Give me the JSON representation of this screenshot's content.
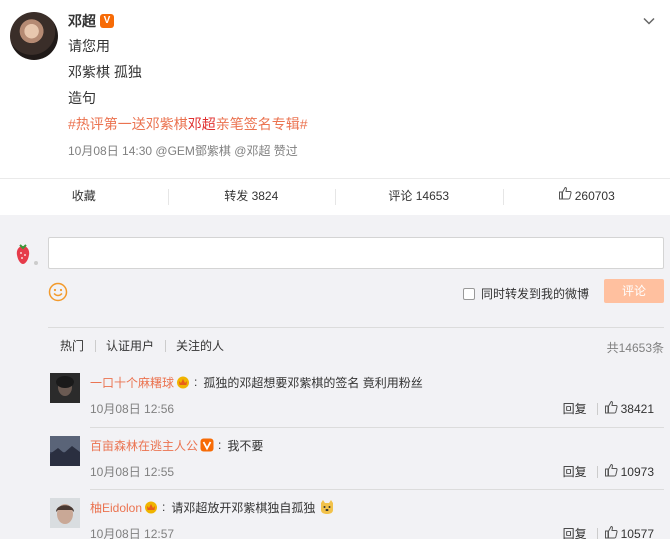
{
  "post": {
    "author": "邓超",
    "badge": "V",
    "lines": [
      "请您用",
      "邓紫棋 孤独",
      "造句"
    ],
    "hashtag_pre": "#热评第一送邓紫棋",
    "hashtag_hl": "邓超",
    "hashtag_post": "亲笔签名专辑#",
    "time": "10月08日 14:30",
    "meta_mentions": "@GEM鄧紫棋 @邓超",
    "meta_suffix": "赞过"
  },
  "actions": {
    "collect": "收藏",
    "forward": "转发 3824",
    "comment": "评论 14653",
    "like_count": "260703"
  },
  "composer": {
    "forward_label": "同时转发到我的微博",
    "submit_label": "评论"
  },
  "tabs": [
    "热门",
    "认证用户",
    "关注的人"
  ],
  "total": "共14653条",
  "comments": [
    {
      "user": "一口十个麻糬球",
      "text": "孤独的邓超想要邓紫棋的签名 竟利用粉丝",
      "time": "10月08日 12:56",
      "reply": "回复",
      "likes": "38421",
      "badge_color": "#f0b400"
    },
    {
      "user": "百亩森林在逃主人公",
      "text": "我不要",
      "time": "10月08日 12:55",
      "reply": "回复",
      "likes": "10973",
      "badge_color": "#f76b06"
    },
    {
      "user": "柚Eidolon",
      "text": "请邓超放开邓紫棋独自孤独",
      "time": "10月08日 12:57",
      "reply": "回复",
      "likes": "10577",
      "badge_color": "#f0b400"
    }
  ],
  "colors": {
    "link": "#eb7350",
    "hl": "#e03030",
    "submit_bg": "#ffc09f",
    "bg": "#f2f2f5"
  }
}
